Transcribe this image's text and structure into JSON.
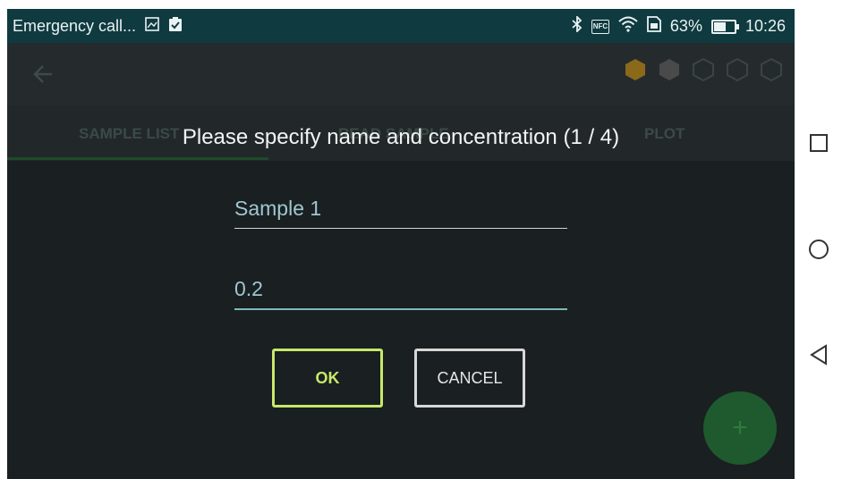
{
  "status_bar": {
    "notification_text": "Emergency call...",
    "battery_percent": "63%",
    "battery_level": 0.63,
    "time": "10:26",
    "icons": [
      "image-icon",
      "clipboard-check-icon",
      "bluetooth-icon",
      "nfc-icon",
      "wifi-icon",
      "sim-icon",
      "battery-icon"
    ],
    "nfc_label": "NFC"
  },
  "app_bar": {
    "back_icon": "back-arrow-icon",
    "progress_hexagons": [
      {
        "state": "filled",
        "color": "#8a6a1a"
      },
      {
        "state": "filled",
        "color": "#4a4a4a"
      },
      {
        "state": "outline",
        "color": "#3a4446"
      },
      {
        "state": "outline",
        "color": "#3a4446"
      },
      {
        "state": "outline",
        "color": "#3a4446"
      }
    ]
  },
  "tabs": [
    {
      "label": "SAMPLE LIST",
      "active": true
    },
    {
      "label": "READ SAMPLE",
      "active": false
    },
    {
      "label": "PLOT",
      "active": false
    }
  ],
  "dialog": {
    "title": "Please specify name and concentration (1 / 4)",
    "name_value": "Sample 1",
    "concentration_value": "0.2",
    "ok_label": "OK",
    "cancel_label": "CANCEL"
  },
  "fab": {
    "icon": "plus-icon",
    "label": "+"
  },
  "nav_bar": {
    "icons": [
      "recents-icon",
      "home-icon",
      "back-icon"
    ]
  },
  "colors": {
    "accent_ok": "#c7e86b",
    "field_text": "#9fc7cf",
    "status_bar_bg": "#0f3a40"
  }
}
